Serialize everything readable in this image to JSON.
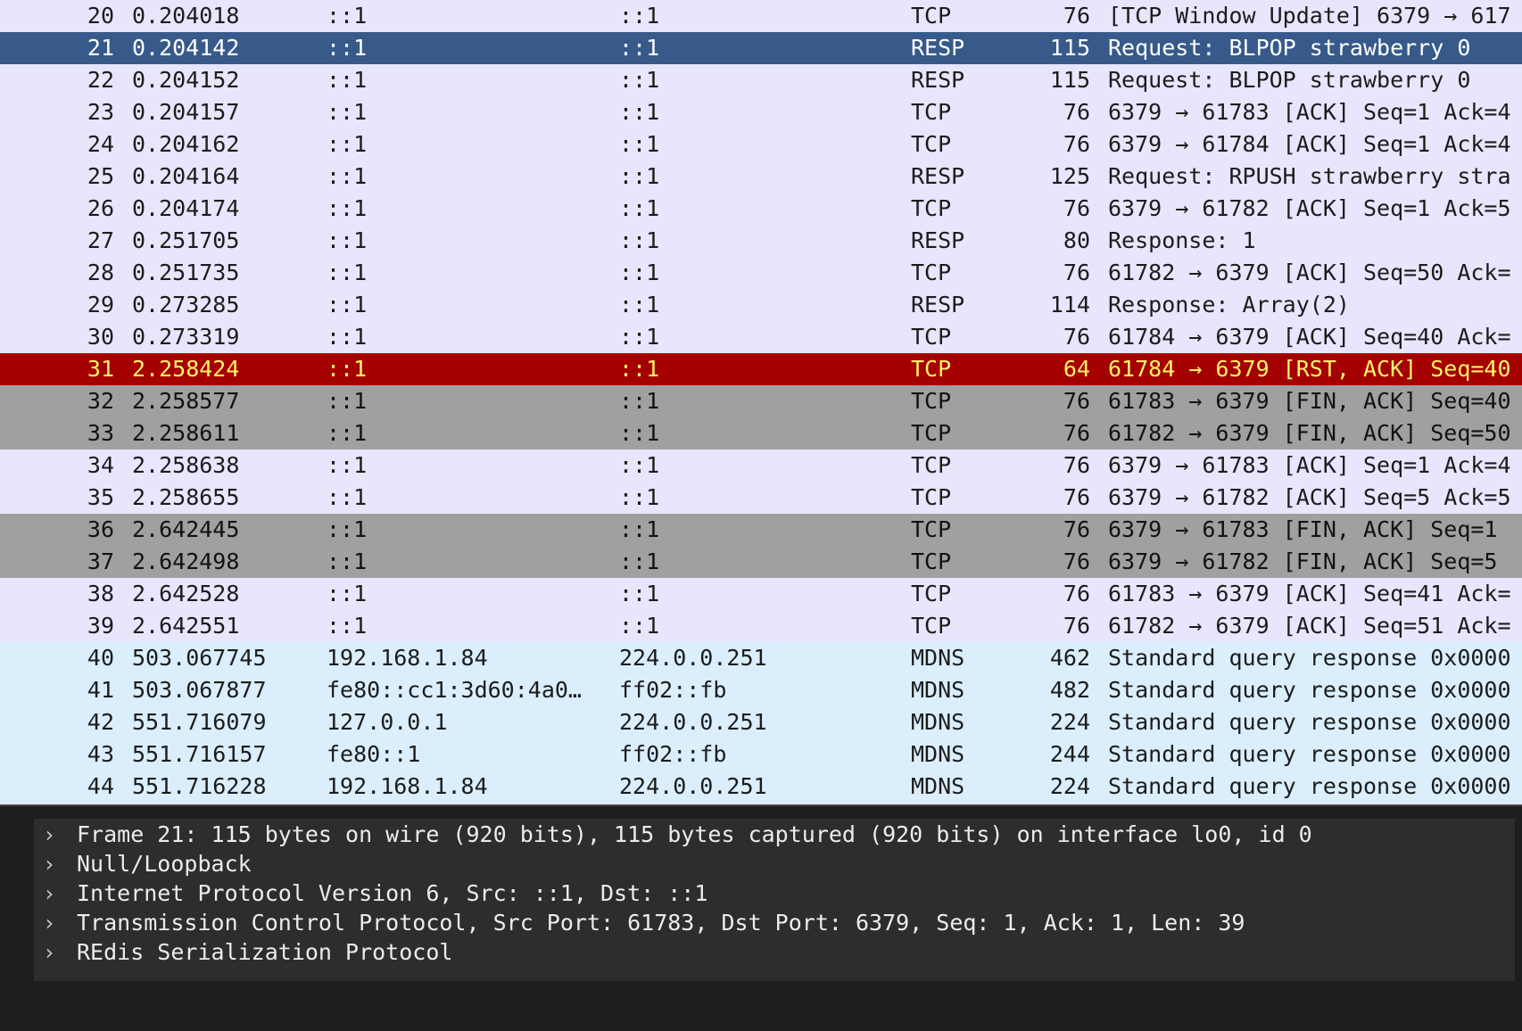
{
  "packets": [
    {
      "no": "20",
      "time": "0.204018",
      "src": "::1",
      "dst": "::1",
      "proto": "TCP",
      "len": "76",
      "info": "[TCP Window Update] 6379 → 617",
      "style": "tcp"
    },
    {
      "no": "21",
      "time": "0.204142",
      "src": "::1",
      "dst": "::1",
      "proto": "RESP",
      "len": "115",
      "info": "Request: BLPOP strawberry 0",
      "style": "sel"
    },
    {
      "no": "22",
      "time": "0.204152",
      "src": "::1",
      "dst": "::1",
      "proto": "RESP",
      "len": "115",
      "info": "Request: BLPOP strawberry 0",
      "style": "tcp"
    },
    {
      "no": "23",
      "time": "0.204157",
      "src": "::1",
      "dst": "::1",
      "proto": "TCP",
      "len": "76",
      "info": "6379 → 61783 [ACK] Seq=1 Ack=4",
      "style": "tcp"
    },
    {
      "no": "24",
      "time": "0.204162",
      "src": "::1",
      "dst": "::1",
      "proto": "TCP",
      "len": "76",
      "info": "6379 → 61784 [ACK] Seq=1 Ack=4",
      "style": "tcp"
    },
    {
      "no": "25",
      "time": "0.204164",
      "src": "::1",
      "dst": "::1",
      "proto": "RESP",
      "len": "125",
      "info": "Request: RPUSH strawberry stra",
      "style": "tcp"
    },
    {
      "no": "26",
      "time": "0.204174",
      "src": "::1",
      "dst": "::1",
      "proto": "TCP",
      "len": "76",
      "info": "6379 → 61782 [ACK] Seq=1 Ack=5",
      "style": "tcp"
    },
    {
      "no": "27",
      "time": "0.251705",
      "src": "::1",
      "dst": "::1",
      "proto": "RESP",
      "len": "80",
      "info": "Response: 1",
      "style": "tcp"
    },
    {
      "no": "28",
      "time": "0.251735",
      "src": "::1",
      "dst": "::1",
      "proto": "TCP",
      "len": "76",
      "info": "61782 → 6379 [ACK] Seq=50 Ack=",
      "style": "tcp"
    },
    {
      "no": "29",
      "time": "0.273285",
      "src": "::1",
      "dst": "::1",
      "proto": "RESP",
      "len": "114",
      "info": "Response: Array(2)",
      "style": "tcp"
    },
    {
      "no": "30",
      "time": "0.273319",
      "src": "::1",
      "dst": "::1",
      "proto": "TCP",
      "len": "76",
      "info": "61784 → 6379 [ACK] Seq=40 Ack=",
      "style": "tcp"
    },
    {
      "no": "31",
      "time": "2.258424",
      "src": "::1",
      "dst": "::1",
      "proto": "TCP",
      "len": "64",
      "info": "61784 → 6379 [RST, ACK] Seq=40",
      "style": "rst"
    },
    {
      "no": "32",
      "time": "2.258577",
      "src": "::1",
      "dst": "::1",
      "proto": "TCP",
      "len": "76",
      "info": "61783 → 6379 [FIN, ACK] Seq=40",
      "style": "fin"
    },
    {
      "no": "33",
      "time": "2.258611",
      "src": "::1",
      "dst": "::1",
      "proto": "TCP",
      "len": "76",
      "info": "61782 → 6379 [FIN, ACK] Seq=50",
      "style": "fin"
    },
    {
      "no": "34",
      "time": "2.258638",
      "src": "::1",
      "dst": "::1",
      "proto": "TCP",
      "len": "76",
      "info": "6379 → 61783 [ACK] Seq=1 Ack=4",
      "style": "tcp"
    },
    {
      "no": "35",
      "time": "2.258655",
      "src": "::1",
      "dst": "::1",
      "proto": "TCP",
      "len": "76",
      "info": "6379 → 61782 [ACK] Seq=5 Ack=5",
      "style": "tcp"
    },
    {
      "no": "36",
      "time": "2.642445",
      "src": "::1",
      "dst": "::1",
      "proto": "TCP",
      "len": "76",
      "info": "6379 → 61783 [FIN, ACK] Seq=1",
      "style": "fin"
    },
    {
      "no": "37",
      "time": "2.642498",
      "src": "::1",
      "dst": "::1",
      "proto": "TCP",
      "len": "76",
      "info": "6379 → 61782 [FIN, ACK] Seq=5",
      "style": "fin"
    },
    {
      "no": "38",
      "time": "2.642528",
      "src": "::1",
      "dst": "::1",
      "proto": "TCP",
      "len": "76",
      "info": "61783 → 6379 [ACK] Seq=41 Ack=",
      "style": "tcp"
    },
    {
      "no": "39",
      "time": "2.642551",
      "src": "::1",
      "dst": "::1",
      "proto": "TCP",
      "len": "76",
      "info": "61782 → 6379 [ACK] Seq=51 Ack=",
      "style": "tcp"
    },
    {
      "no": "40",
      "time": "503.067745",
      "src": "192.168.1.84",
      "dst": "224.0.0.251",
      "proto": "MDNS",
      "len": "462",
      "info": "Standard query response 0x0000",
      "style": "mdns"
    },
    {
      "no": "41",
      "time": "503.067877",
      "src": "fe80::cc1:3d60:4a0…",
      "dst": "ff02::fb",
      "proto": "MDNS",
      "len": "482",
      "info": "Standard query response 0x0000",
      "style": "mdns"
    },
    {
      "no": "42",
      "time": "551.716079",
      "src": "127.0.0.1",
      "dst": "224.0.0.251",
      "proto": "MDNS",
      "len": "224",
      "info": "Standard query response 0x0000",
      "style": "mdns"
    },
    {
      "no": "43",
      "time": "551.716157",
      "src": "fe80::1",
      "dst": "ff02::fb",
      "proto": "MDNS",
      "len": "244",
      "info": "Standard query response 0x0000",
      "style": "mdns"
    },
    {
      "no": "44",
      "time": "551.716228",
      "src": "192.168.1.84",
      "dst": "224.0.0.251",
      "proto": "MDNS",
      "len": "224",
      "info": "Standard query response 0x0000",
      "style": "mdns"
    }
  ],
  "details": [
    {
      "chevron": "›",
      "text": "Frame 21: 115 bytes on wire (920 bits), 115 bytes captured (920 bits) on interface lo0, id 0"
    },
    {
      "chevron": "›",
      "text": "Null/Loopback"
    },
    {
      "chevron": "›",
      "text": "Internet Protocol Version 6, Src: ::1, Dst: ::1"
    },
    {
      "chevron": "›",
      "text": "Transmission Control Protocol, Src Port: 61783, Dst Port: 6379, Seq: 1, Ack: 1, Len: 39"
    },
    {
      "chevron": "›",
      "text": "REdis Serialization Protocol"
    }
  ],
  "colors": {
    "tcp_row": "#e7e6fc",
    "mdns_row": "#daeefc",
    "selected_row": "#375a8b",
    "rst_row": "#a40000",
    "rst_text": "#fff26a",
    "fin_row": "#a0a0a0",
    "details_bg": "#2d2d2d"
  }
}
